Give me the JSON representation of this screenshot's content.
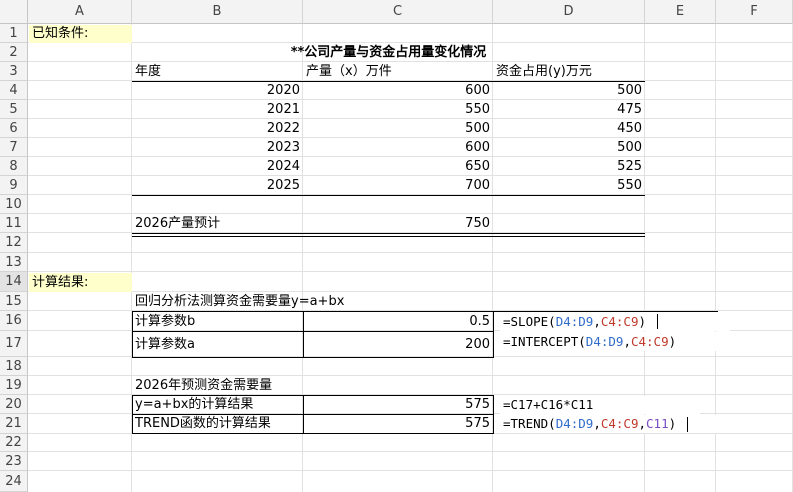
{
  "columns": [
    "A",
    "B",
    "C",
    "D",
    "E",
    "F"
  ],
  "rows": [
    "1",
    "2",
    "3",
    "4",
    "5",
    "6",
    "7",
    "8",
    "9",
    "10",
    "11",
    "12",
    "13",
    "14",
    "15",
    "16",
    "17",
    "18",
    "19",
    "20",
    "21",
    "22",
    "23",
    "24"
  ],
  "cells": {
    "a1": "已知条件:",
    "title": "**公司产量与资金占用量变化情况",
    "h_year": "年度",
    "h_output": "产量（x）万件",
    "h_capital": "资金占用(y)万元",
    "data": [
      {
        "year": "2020",
        "x": "600",
        "y": "500"
      },
      {
        "year": "2021",
        "x": "550",
        "y": "475"
      },
      {
        "year": "2022",
        "x": "500",
        "y": "450"
      },
      {
        "year": "2023",
        "x": "600",
        "y": "500"
      },
      {
        "year": "2024",
        "x": "650",
        "y": "525"
      },
      {
        "year": "2025",
        "x": "700",
        "y": "550"
      }
    ],
    "forecast_label": "2026产量预计",
    "forecast_value": "750",
    "a14": "计算结果:",
    "b15": "回归分析法测算资金需要量y=a+bx",
    "b16": "计算参数b",
    "c16": "0.5",
    "b17": "计算参数a",
    "c17": "200",
    "b19": "2026年预测资金需要量",
    "b20": "y=a+bx的计算结果",
    "c20": "575",
    "b21": "TREND函数的计算结果",
    "c21": "575"
  },
  "formulas": {
    "f16": {
      "pre": "=SLOPE(",
      "r1": "D4:D9",
      "sep": ",",
      "r2": "C4:C9",
      "post": ")"
    },
    "f17": {
      "pre": "=INTERCEPT(",
      "r1": "D4:D9",
      "sep": ",",
      "r2": "C4:C9",
      "post": ")"
    },
    "f20": "=C17+C16*C11",
    "f21": {
      "pre": "=TREND(",
      "r1": "D4:D9",
      "sep1": ",",
      "r2": "C4:C9",
      "sep2": ",",
      "r3": "C11",
      "post": ")"
    }
  },
  "colors": {
    "highlight": "#ffffcc",
    "ref_blue": "#2f6cc9",
    "ref_red": "#c0392b",
    "ref_purple": "#7a4cc2"
  }
}
